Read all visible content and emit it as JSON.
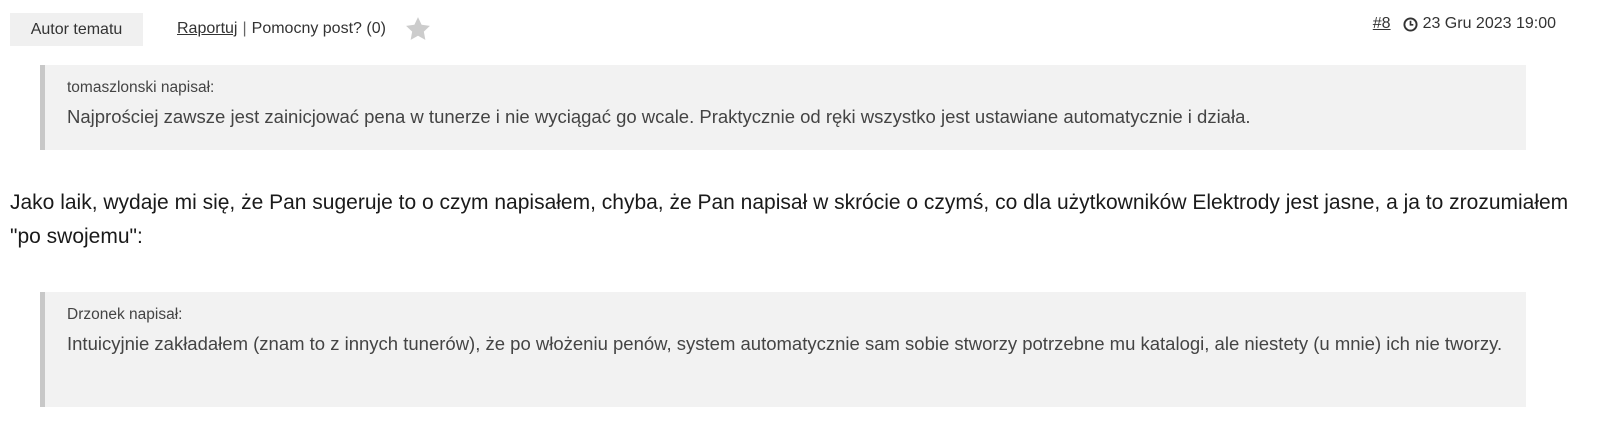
{
  "post": {
    "author_badge": "Autor tematu",
    "report_label": "Raportuj",
    "separator": "|",
    "helpful_label": "Pomocny post? (0)",
    "post_number": "#8",
    "timestamp": "23 Gru 2023 19:00",
    "body": "Jako laik, wydaje mi się, że Pan sugeruje to o czym napisałem, chyba, że Pan napisał w skrócie o czymś, co dla użytkowników Elektrody jest jasne, a ja to zrozumiałem \"po swojemu\":"
  },
  "quotes": [
    {
      "author": "tomaszlonski napisał:",
      "text": "Najprościej zawsze jest zainicjować pena w tunerze i nie wyciągać go wcale. Praktycznie od ręki wszystko jest ustawiane automatycznie i działa."
    },
    {
      "author": "Drzonek napisał:",
      "text": "Intuicyjnie zakładałem (znam to z innych tunerów), że po włożeniu penów, system automatycznie sam sobie stworzy potrzebne mu katalogi, ale niestety (u mnie) ich nie tworzy."
    }
  ],
  "icons": {
    "helpful": "star-icon",
    "time": "clock-icon"
  },
  "colors": {
    "badge_bg": "#f0f0f0",
    "quote_bg": "#f2f2f2",
    "quote_border": "#c8c8c8",
    "star": "#cccccc"
  }
}
